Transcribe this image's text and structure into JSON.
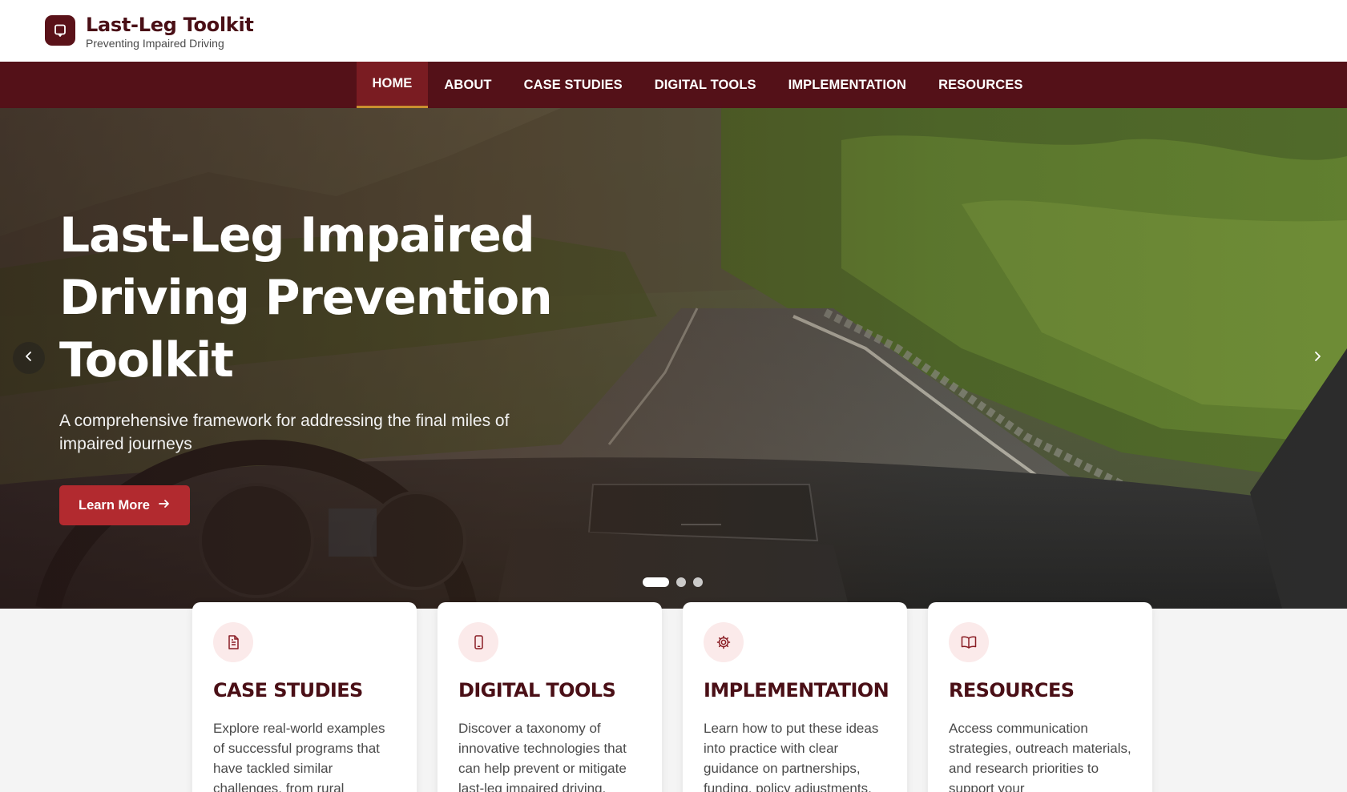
{
  "brand": {
    "title": "Last-Leg Toolkit",
    "subtitle": "Preventing Impaired Driving",
    "logo_icon": "chat-bubble-icon"
  },
  "nav": {
    "items": [
      {
        "label": "HOME",
        "active": true
      },
      {
        "label": "ABOUT",
        "active": false
      },
      {
        "label": "CASE STUDIES",
        "active": false
      },
      {
        "label": "DIGITAL TOOLS",
        "active": false
      },
      {
        "label": "IMPLEMENTATION",
        "active": false
      },
      {
        "label": "RESOURCES",
        "active": false
      }
    ]
  },
  "hero": {
    "title": "Last-Leg Impaired Driving Prevention Toolkit",
    "description": "A comprehensive framework for addressing the final miles of impaired journeys",
    "button_label": "Learn More",
    "slides_count": 3,
    "active_slide": 1
  },
  "cards": [
    {
      "icon": "document-icon",
      "title": "CASE STUDIES",
      "text": "Explore real-world examples of successful programs that have tackled similar challenges, from rural"
    },
    {
      "icon": "mobile-phone-icon",
      "title": "DIGITAL TOOLS",
      "text": "Discover a taxonomy of innovative technologies that can help prevent or mitigate last-leg impaired driving,"
    },
    {
      "icon": "gear-icon",
      "title": "IMPLEMENTATION",
      "text": "Learn how to put these ideas into practice with clear guidance on partnerships, funding, policy adjustments,"
    },
    {
      "icon": "open-book-icon",
      "title": "RESOURCES",
      "text": "Access communication strategies, outreach materials, and research priorities to support your"
    }
  ],
  "colors": {
    "brand_dark": "#541118",
    "accent_red": "#b22a2f",
    "active_underline": "#c9902f"
  }
}
